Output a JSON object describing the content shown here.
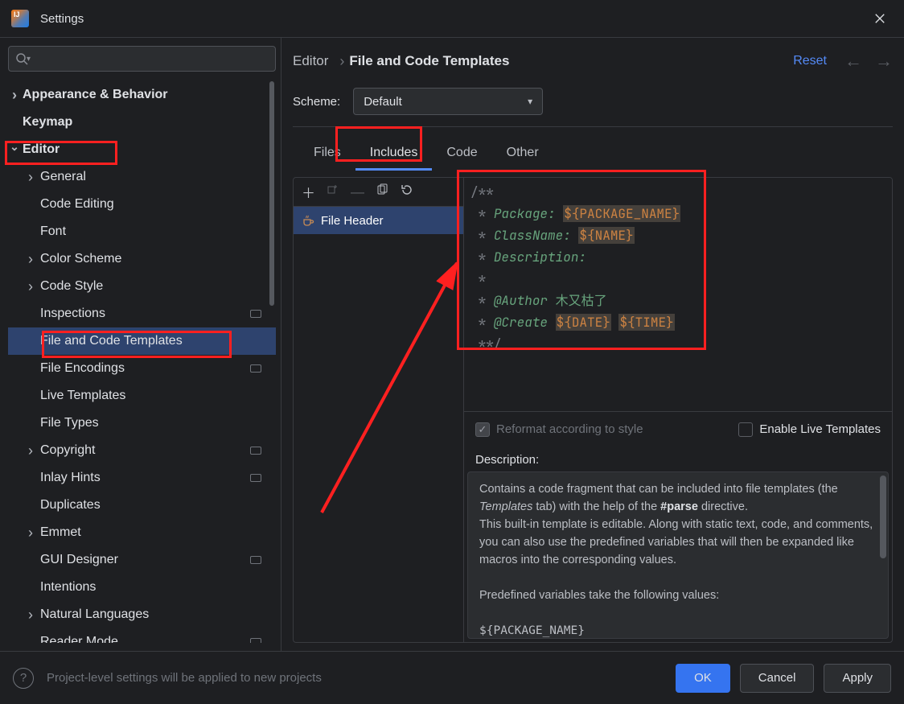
{
  "window": {
    "title": "Settings"
  },
  "breadcrumb": {
    "root": "Editor",
    "leaf": "File and Code Templates"
  },
  "actions": {
    "reset": "Reset"
  },
  "scheme": {
    "label": "Scheme:",
    "value": "Default"
  },
  "tabs": {
    "files": "Files",
    "includes": "Includes",
    "code": "Code",
    "other": "Other"
  },
  "sidebar": {
    "items": [
      {
        "label": "Appearance & Behavior",
        "level": 0,
        "bold": true,
        "arrow": "right"
      },
      {
        "label": "Keymap",
        "level": 0,
        "bold": true
      },
      {
        "label": "Editor",
        "level": 0,
        "bold": true,
        "arrow": "down"
      },
      {
        "label": "General",
        "level": 1,
        "arrow": "right"
      },
      {
        "label": "Code Editing",
        "level": 1
      },
      {
        "label": "Font",
        "level": 1
      },
      {
        "label": "Color Scheme",
        "level": 1,
        "arrow": "right"
      },
      {
        "label": "Code Style",
        "level": 1,
        "arrow": "right"
      },
      {
        "label": "Inspections",
        "level": 1,
        "badge": true
      },
      {
        "label": "File and Code Templates",
        "level": 1,
        "selected": true
      },
      {
        "label": "File Encodings",
        "level": 1,
        "badge": true
      },
      {
        "label": "Live Templates",
        "level": 1
      },
      {
        "label": "File Types",
        "level": 1
      },
      {
        "label": "Copyright",
        "level": 1,
        "arrow": "right",
        "badge": true
      },
      {
        "label": "Inlay Hints",
        "level": 1,
        "badge": true
      },
      {
        "label": "Duplicates",
        "level": 1
      },
      {
        "label": "Emmet",
        "level": 1,
        "arrow": "right"
      },
      {
        "label": "GUI Designer",
        "level": 1,
        "badge": true
      },
      {
        "label": "Intentions",
        "level": 1
      },
      {
        "label": "Natural Languages",
        "level": 1,
        "arrow": "right"
      },
      {
        "label": "Reader Mode",
        "level": 1,
        "badge": true
      }
    ]
  },
  "list": {
    "item0": "File Header"
  },
  "code": {
    "l1a": "/**",
    "l2a": " * ",
    "l2b": "Package: ",
    "l2c": "${PACKAGE_NAME}",
    "l3a": " * ",
    "l3b": "ClassName: ",
    "l3c": "${NAME}",
    "l4a": " * ",
    "l4b": "Description:",
    "l5a": " *",
    "l6a": " * ",
    "l6b": "@Author ",
    "l6c": "木又枯了",
    "l7a": " * ",
    "l7b": "@Create ",
    "l7c": "${DATE}",
    "l7d": " ",
    "l7e": "${TIME}",
    "l8a": " **/"
  },
  "options": {
    "reformat": "Reformat according to style",
    "liveTemplates": "Enable Live Templates"
  },
  "description": {
    "label": "Description:",
    "p1a": "Contains a code fragment that can be included into file templates (the ",
    "p1b": "Templates",
    "p1c": " tab) with the help of the ",
    "p1d": "#parse",
    "p1e": " directive.",
    "p2": "This built-in template is editable. Along with static text, code, and comments, you can also use the predefined variables that will then be expanded like macros into the corresponding values.",
    "p3": "Predefined variables take the following values:",
    "p4": "${PACKAGE_NAME}"
  },
  "bottom": {
    "hint": "Project-level settings will be applied to new projects",
    "ok": "OK",
    "cancel": "Cancel",
    "apply": "Apply"
  }
}
